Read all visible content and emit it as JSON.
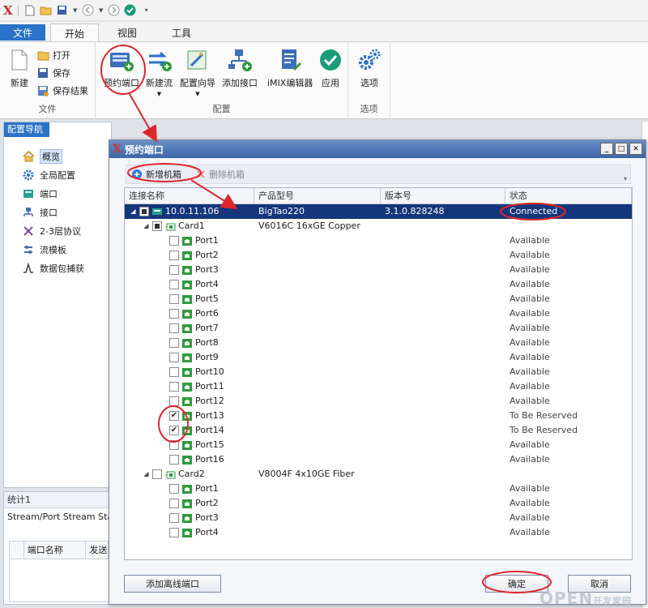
{
  "quick_access": {
    "logo": "X"
  },
  "ribbon": {
    "tabs": [
      "文件",
      "开始",
      "视图",
      "工具"
    ],
    "groups": {
      "file": {
        "label": "文件",
        "new": "新建",
        "open": "打开",
        "save": "保存",
        "save_result": "保存结果"
      },
      "config": {
        "label": "配置",
        "reserve_port": "预约端口",
        "new_stream": "新建流",
        "config_wizard": "配置向导",
        "add_interface": "添加接口",
        "imix_editor": "iMIX编辑器",
        "apply": "应用"
      },
      "options": {
        "label": "选项",
        "options": "选项"
      }
    }
  },
  "nav": {
    "title": "配置导航",
    "items": [
      {
        "label": "概览",
        "icon": "home-icon",
        "selected": true
      },
      {
        "label": "全局配置",
        "icon": "gear-icon"
      },
      {
        "label": "端口",
        "icon": "port-icon"
      },
      {
        "label": "接口",
        "icon": "interface-icon"
      },
      {
        "label": "2-3层协议",
        "icon": "protocol-icon"
      },
      {
        "label": "流模板",
        "icon": "stream-template-icon"
      },
      {
        "label": "数据包捕获",
        "icon": "capture-icon"
      }
    ]
  },
  "stats": {
    "tab": "统计1",
    "subtitle": "Stream/Port Stream Stat",
    "columns": [
      "端口名称",
      "发送"
    ]
  },
  "dialog": {
    "title": "预约端口",
    "toolbar": {
      "add_chassis": "新增机箱",
      "delete_chassis": "删除机箱"
    },
    "columns": [
      "连接名称",
      "产品型号",
      "版本号",
      "状态"
    ],
    "chassis": {
      "name": "10.0.11.106",
      "model": "BigTao220",
      "version": "3.1.0.828248",
      "status": "Connected"
    },
    "cards": [
      {
        "name": "Card1",
        "model": "V6016C 16xGE Copper",
        "ports": [
          {
            "name": "Port1",
            "status": "Available",
            "checked": false
          },
          {
            "name": "Port2",
            "status": "Available",
            "checked": false
          },
          {
            "name": "Port3",
            "status": "Available",
            "checked": false
          },
          {
            "name": "Port4",
            "status": "Available",
            "checked": false
          },
          {
            "name": "Port5",
            "status": "Available",
            "checked": false
          },
          {
            "name": "Port6",
            "status": "Available",
            "checked": false
          },
          {
            "name": "Port7",
            "status": "Available",
            "checked": false
          },
          {
            "name": "Port8",
            "status": "Available",
            "checked": false
          },
          {
            "name": "Port9",
            "status": "Available",
            "checked": false
          },
          {
            "name": "Port10",
            "status": "Available",
            "checked": false
          },
          {
            "name": "Port11",
            "status": "Available",
            "checked": false
          },
          {
            "name": "Port12",
            "status": "Available",
            "checked": false
          },
          {
            "name": "Port13",
            "status": "To Be Reserved",
            "checked": true
          },
          {
            "name": "Port14",
            "status": "To Be Reserved",
            "checked": true
          },
          {
            "name": "Port15",
            "status": "Available",
            "checked": false
          },
          {
            "name": "Port16",
            "status": "Available",
            "checked": false
          }
        ]
      },
      {
        "name": "Card2",
        "model": "V8004F 4x10GE Fiber",
        "ports": [
          {
            "name": "Port1",
            "status": "Available",
            "checked": false
          },
          {
            "name": "Port2",
            "status": "Available",
            "checked": false
          },
          {
            "name": "Port3",
            "status": "Available",
            "checked": false
          },
          {
            "name": "Port4",
            "status": "Available",
            "checked": false
          }
        ]
      }
    ],
    "buttons": {
      "add_offline_port": "添加离线端口",
      "ok": "确定",
      "cancel": "取消"
    }
  },
  "watermark": {
    "text": "OPEN",
    "sub": "开发家园"
  },
  "colors": {
    "accent": "#2a72c8",
    "selected_row": "#15367a",
    "annotation": "#e0262b",
    "port_green": "#2e9b3c"
  }
}
